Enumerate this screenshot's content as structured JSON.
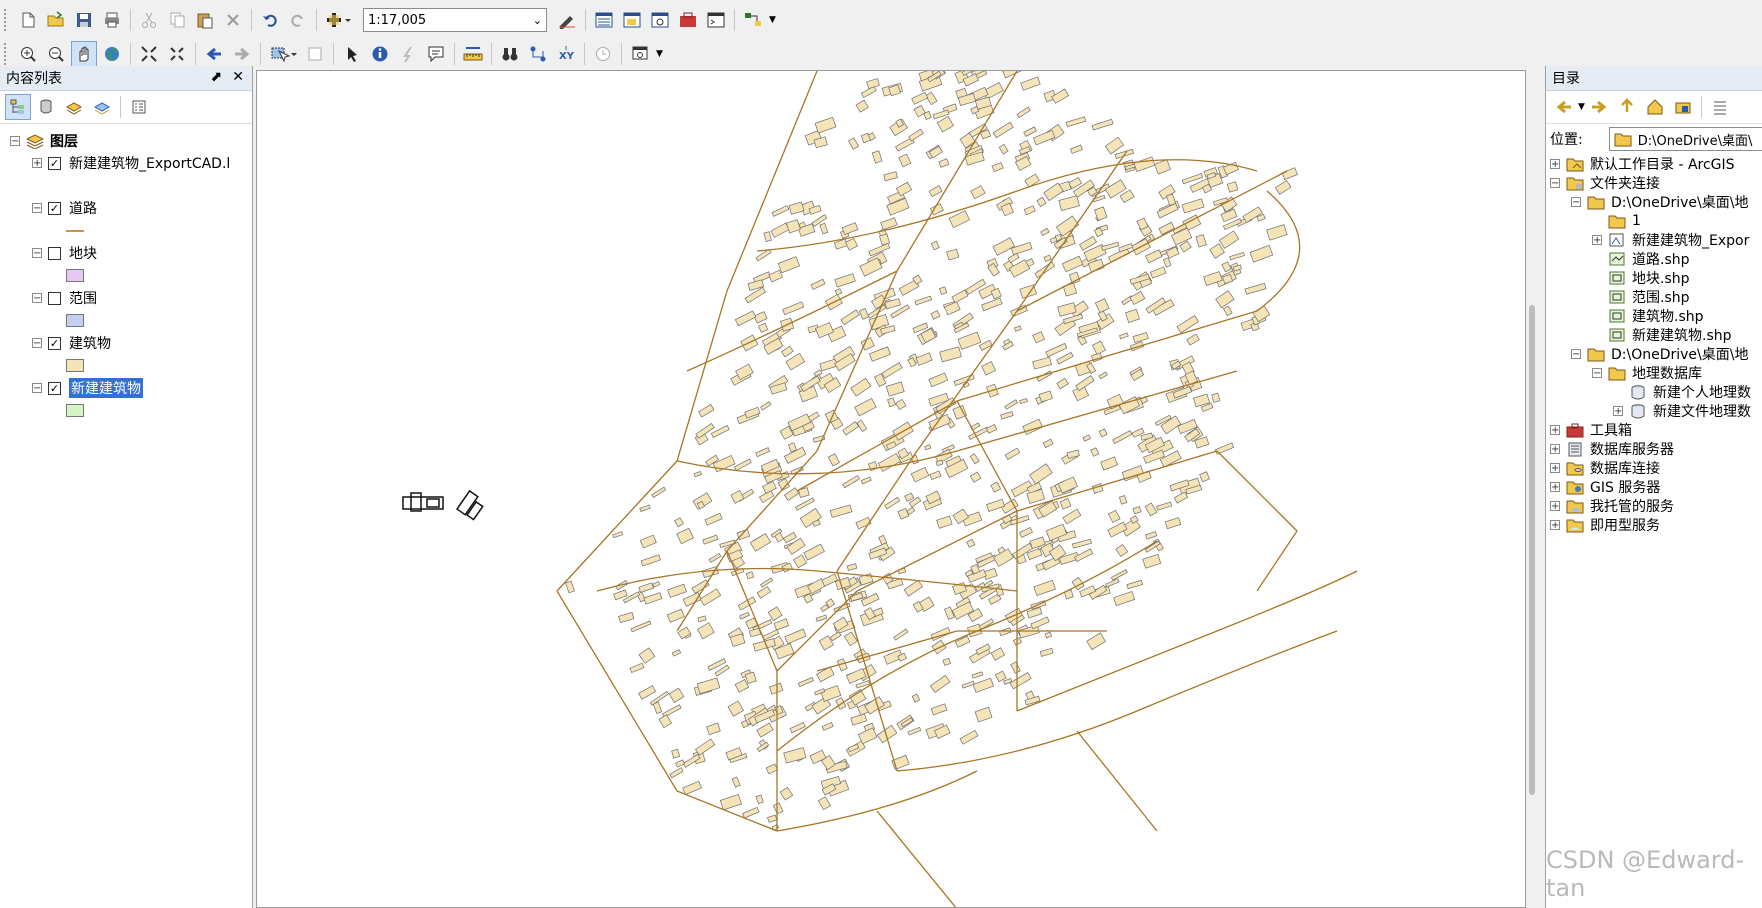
{
  "toolbar": {
    "scale_value": "1:17,005"
  },
  "toc": {
    "title": "内容列表",
    "root_label": "图层",
    "layers": [
      {
        "label": "新建建筑物_ExportCAD.l",
        "checked": true,
        "expand": "+",
        "symbol_color": null
      },
      {
        "label": "道路",
        "checked": true,
        "expand": "−",
        "symbol_color": "#c8963c",
        "symbol_type": "line"
      },
      {
        "label": "地块",
        "checked": false,
        "expand": "−",
        "symbol_color": "#e6c9f2",
        "symbol_type": "fill"
      },
      {
        "label": "范围",
        "checked": false,
        "expand": "−",
        "symbol_color": "#c4cff2",
        "symbol_type": "fill"
      },
      {
        "label": "建筑物",
        "checked": true,
        "expand": "−",
        "symbol_color": "#f5e4b8",
        "symbol_type": "fill"
      },
      {
        "label": "新建建筑物",
        "checked": true,
        "expand": "−",
        "symbol_color": "#d6f5c4",
        "symbol_type": "fill",
        "selected": true
      }
    ]
  },
  "catalog": {
    "title": "目录",
    "location_label": "位置:",
    "location_value": "D:\\OneDrive\\桌面\\",
    "items": [
      {
        "label": "默认工作目录 - ArcGIS",
        "expand": "+",
        "icon": "home-folder-icon",
        "level": 0
      },
      {
        "label": "文件夹连接",
        "expand": "−",
        "icon": "folder-connections-icon",
        "level": 0
      },
      {
        "label": "D:\\OneDrive\\桌面\\地",
        "expand": "−",
        "icon": "folder-icon",
        "level": 1
      },
      {
        "label": "1",
        "expand": "",
        "icon": "folder-icon",
        "level": 2
      },
      {
        "label": "新建建筑物_Expor",
        "expand": "+",
        "icon": "cad-icon",
        "level": 2
      },
      {
        "label": "道路.shp",
        "expand": "",
        "icon": "shapefile-line-icon",
        "level": 2
      },
      {
        "label": "地块.shp",
        "expand": "",
        "icon": "shapefile-polygon-icon",
        "level": 2
      },
      {
        "label": "范围.shp",
        "expand": "",
        "icon": "shapefile-polygon-icon",
        "level": 2
      },
      {
        "label": "建筑物.shp",
        "expand": "",
        "icon": "shapefile-polygon-icon",
        "level": 2
      },
      {
        "label": "新建建筑物.shp",
        "expand": "",
        "icon": "shapefile-polygon-icon",
        "level": 2
      },
      {
        "label": "D:\\OneDrive\\桌面\\地",
        "expand": "−",
        "icon": "folder-icon",
        "level": 1
      },
      {
        "label": "地理数据库",
        "expand": "−",
        "icon": "folder-icon",
        "level": 2
      },
      {
        "label": "新建个人地理数",
        "expand": "",
        "icon": "geodatabase-icon",
        "level": 3
      },
      {
        "label": "新建文件地理数",
        "expand": "+",
        "icon": "geodatabase-icon",
        "level": 3
      },
      {
        "label": "工具箱",
        "expand": "+",
        "icon": "toolbox-icon",
        "level": 0
      },
      {
        "label": "数据库服务器",
        "expand": "+",
        "icon": "database-server-icon",
        "level": 0
      },
      {
        "label": "数据库连接",
        "expand": "+",
        "icon": "database-connection-icon",
        "level": 0
      },
      {
        "label": "GIS 服务器",
        "expand": "+",
        "icon": "gis-server-icon",
        "level": 0
      },
      {
        "label": "我托管的服务",
        "expand": "+",
        "icon": "hosted-services-icon",
        "level": 0
      },
      {
        "label": "即用型服务",
        "expand": "+",
        "icon": "ready-services-icon",
        "level": 0
      }
    ]
  },
  "watermark": "CSDN @Edward-tan",
  "colors": {
    "road": "#a87524",
    "building_fill": "#f5e4b8",
    "building_stroke": "#6e6e6e",
    "selection": "#3370d4"
  }
}
